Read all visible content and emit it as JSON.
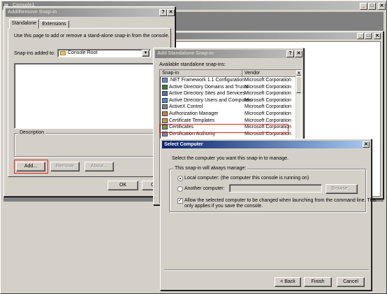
{
  "console_window": {
    "title": "Console1",
    "menu_min": "_",
    "menu_max": "□",
    "menu_close": "✕"
  },
  "inner_window": {
    "min": "_",
    "max": "□",
    "close": "✕"
  },
  "add_remove": {
    "title": "Add/Remove Snap-in",
    "help": "?",
    "close": "✕",
    "tabs": [
      "Standalone",
      "Extensions"
    ],
    "intro": "Use this page to add or remove a stand-alone snap-in from the console.",
    "snapins_label": "Snap-ins added to:",
    "snapins_value": "Console Root",
    "description_label": "Description",
    "add_button": "Add...",
    "remove_button": "Remove",
    "about_button": "About...",
    "ok_button": "OK",
    "cancel_button": "Ca"
  },
  "add_standalone": {
    "title": "Add Standalone Snap-in",
    "help": "?",
    "close": "✕",
    "available_label": "Available standalone snap-ins:",
    "col_snapin": "Snap-in",
    "col_vendor": "Vendor",
    "items": [
      {
        "name": ".NET Framework 1.1 Configuration",
        "vendor": "Microsoft Corporation",
        "icon": "gear-icon"
      },
      {
        "name": "Active Directory Domains and Trusts",
        "vendor": "Microsoft Corporation",
        "icon": "domains-icon"
      },
      {
        "name": "Active Directory Sites and Services",
        "vendor": "Microsoft Corporation",
        "icon": "sites-icon"
      },
      {
        "name": "Active Directory Users and Computers",
        "vendor": "Microsoft Corporation",
        "icon": "users-icon"
      },
      {
        "name": "ActiveX Control",
        "vendor": "Microsoft Corporation",
        "icon": "activex-icon"
      },
      {
        "name": "Authorization Manager",
        "vendor": "Microsoft Corporation",
        "icon": "authorization-icon"
      },
      {
        "name": "Certificate Templates",
        "vendor": "Microsoft Corporation",
        "icon": "template-icon"
      },
      {
        "name": "Certificates",
        "vendor": "Microsoft Corporation",
        "icon": "certificates-icon"
      },
      {
        "name": "Certification Authority",
        "vendor": "Microsoft Corporation",
        "icon": "ca-icon"
      }
    ]
  },
  "select_computer": {
    "title": "Select Computer",
    "close": "✕",
    "prompt": "Select the computer you want this snap-in to manage.",
    "group_label": "This snap-in will always manage:",
    "local_option": "Local computer:  (the computer this console is running on)",
    "another_option": "Another computer:",
    "another_value": "",
    "browse_button": "Browse...",
    "allow_line1": "Allow the selected computer to be changed when launching from the command line.  This",
    "allow_line2": "only applies if you save the console.",
    "allow_checked": "✓",
    "back_button": "< Back",
    "finish_button": "Finish",
    "cancel_button": "Cancel"
  }
}
